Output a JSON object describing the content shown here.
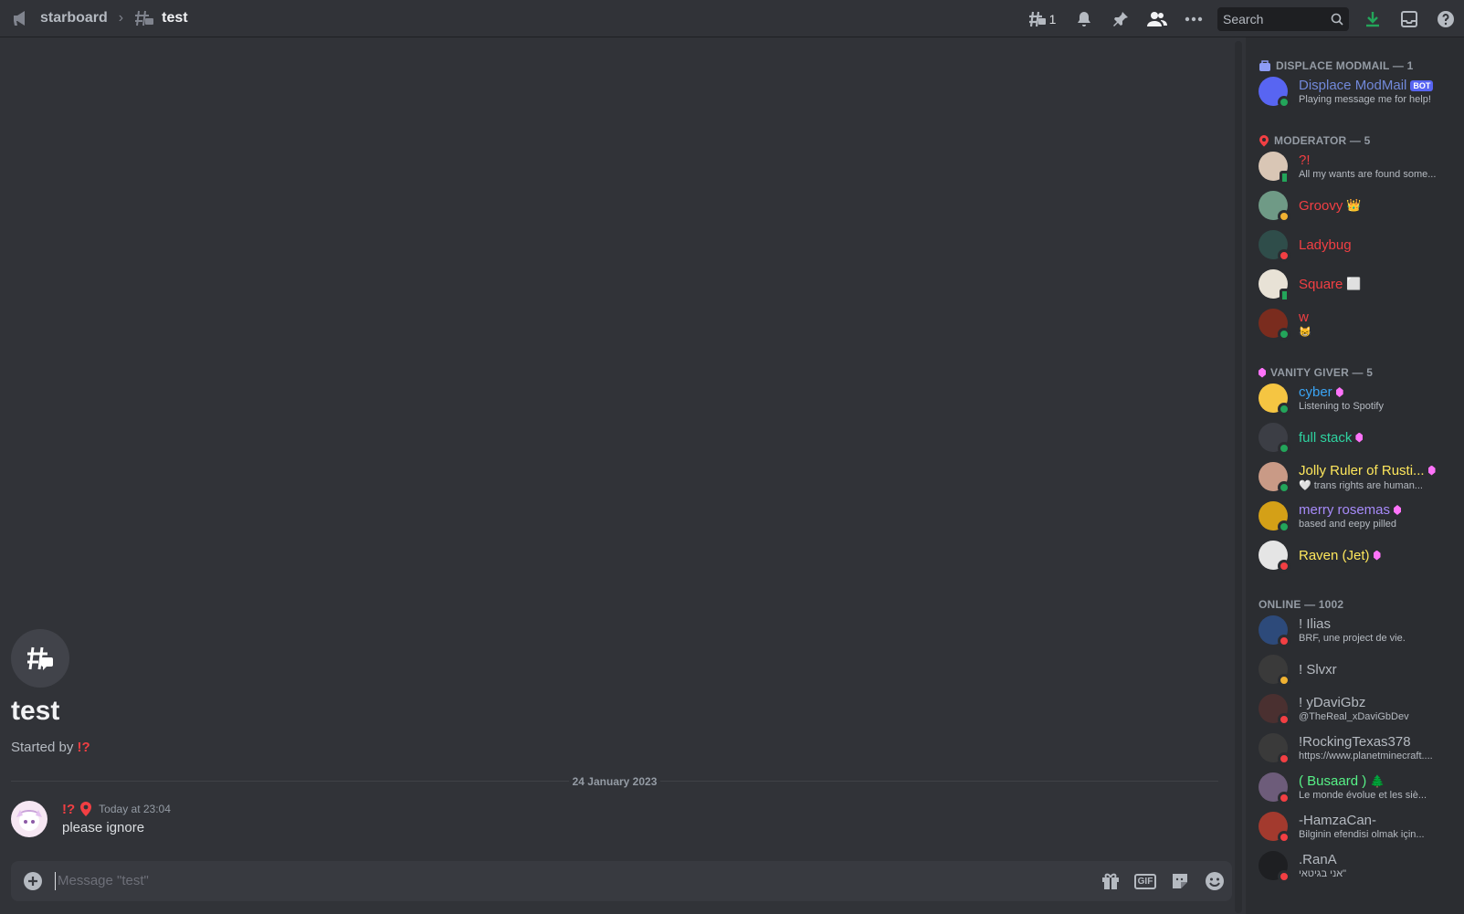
{
  "topbar": {
    "parent_channel": "starboard",
    "thread_title": "test",
    "threads_count": "1",
    "search_placeholder": "Search"
  },
  "thread": {
    "title": "test",
    "started_prefix": "Started by ",
    "started_by": "!?",
    "date_divider": "24 January 2023"
  },
  "message": {
    "author": "!?",
    "timestamp": "Today at 23:04",
    "text": "please ignore"
  },
  "composer": {
    "placeholder": "Message \"test\"",
    "gif_label": "GIF"
  },
  "members": {
    "groups": [
      {
        "label": "DISPLACE MODMAIL — 1"
      },
      {
        "label": "MODERATOR — 5"
      },
      {
        "label": "VANITY GIVER — 5"
      },
      {
        "label": "ONLINE — 1002"
      }
    ],
    "list": [
      {
        "name": "Displace ModMail",
        "sub": "Playing message me for help!",
        "badge": "BOT",
        "color": "#7289da",
        "avatar": "#5865f2",
        "status": "online"
      },
      {
        "name": "?!",
        "sub": "All my wants are found some...",
        "color": "#f23f43",
        "avatar": "#d9c6b5",
        "status": "mobile"
      },
      {
        "name": "Groovy",
        "sub": "",
        "suffix": "👑",
        "color": "#f23f43",
        "avatar": "#6f9a86",
        "status": "idle"
      },
      {
        "name": "Ladybug",
        "sub": "",
        "color": "#f23f43",
        "avatar": "#2f4d4a",
        "status": "dnd"
      },
      {
        "name": "Square",
        "sub": "",
        "suffix": "⬜",
        "color": "#f23f43",
        "avatar": "#e8e2d6",
        "status": "mobile"
      },
      {
        "name": "w",
        "sub": "😸",
        "color": "#f23f43",
        "avatar": "#7a2c1e",
        "status": "online"
      },
      {
        "name": "cyber",
        "sub": "Listening to Spotify",
        "color": "#3ba5f5",
        "avatar": "#f5c542",
        "status": "online",
        "gem": true
      },
      {
        "name": "full stack",
        "sub": "",
        "color": "#2ed3a0",
        "avatar": "#3c3e45",
        "status": "online",
        "gem": true
      },
      {
        "name": "Jolly Ruler of Rusti...",
        "sub": "🤍 trans rights are human...",
        "color": "#fee75c",
        "avatar": "#c99a86",
        "status": "online",
        "gem": true
      },
      {
        "name": "merry rosemas",
        "sub": "based and eepy pilled",
        "color": "#a78bfa",
        "avatar": "#d4a017",
        "status": "online",
        "gem": true
      },
      {
        "name": "Raven (Jet)",
        "sub": "",
        "color": "#fee75c",
        "avatar": "#e5e5e5",
        "status": "dnd",
        "gem": true
      },
      {
        "name": "! Ilias",
        "sub": "BRF, une project de vie.",
        "color": "#b5bac1",
        "avatar": "#2d4a7a",
        "status": "dnd"
      },
      {
        "name": "! Slvxr",
        "sub": "",
        "color": "#b5bac1",
        "avatar": "#3a3a3a",
        "status": "idle"
      },
      {
        "name": "! yDaviGbz",
        "sub": "@TheReal_xDaviGbDev",
        "color": "#b5bac1",
        "avatar": "#4a3030",
        "status": "dnd"
      },
      {
        "name": "!RockingTexas378",
        "sub": "https://www.planetminecraft....",
        "color": "#b5bac1",
        "avatar": "#3a3a3a",
        "status": "dnd"
      },
      {
        "name": "( Busaard )",
        "sub": "Le monde évolue et les siè...",
        "suffix": "🌲",
        "color": "#57f287",
        "avatar": "#6d5c7a",
        "status": "dnd"
      },
      {
        "name": "-HamzaCan-",
        "sub": "Bilginin efendisi olmak için...",
        "color": "#b5bac1",
        "avatar": "#a33a2e",
        "status": "dnd"
      },
      {
        "name": ".RanA",
        "sub": "אני בגיטאי\"",
        "color": "#b5bac1",
        "avatar": "#1e1f22",
        "status": "dnd"
      }
    ]
  }
}
